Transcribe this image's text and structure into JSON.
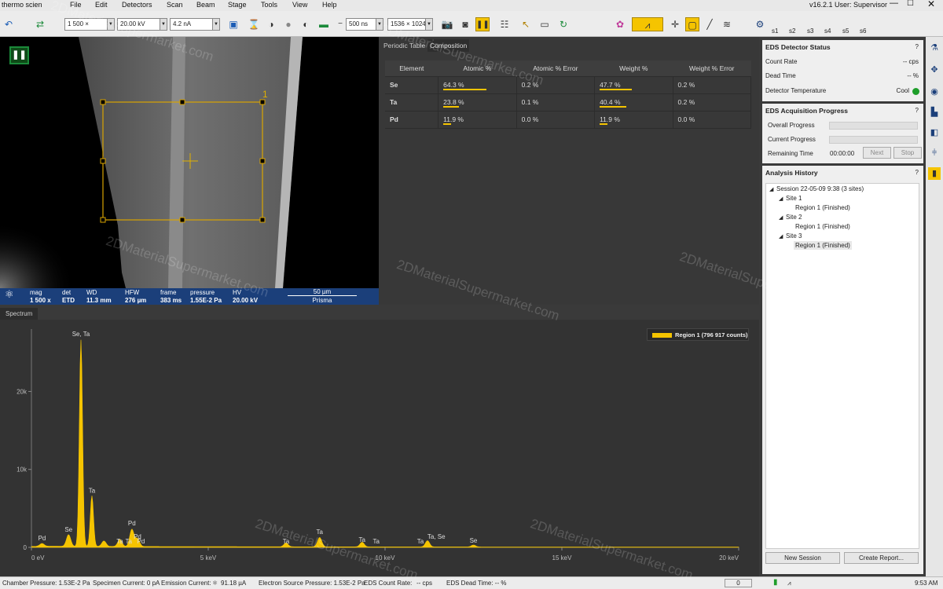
{
  "app": {
    "title": "thermo scien",
    "version": "v16.2.1",
    "user": "User: Supervisor"
  },
  "menu": [
    "File",
    "Edit",
    "Detectors",
    "Scan",
    "Beam",
    "Stage",
    "Tools",
    "View",
    "Help"
  ],
  "toolbar": {
    "mag": "1 500 ×",
    "hv": "20.00 kV",
    "current": "4.2 nA",
    "dwell": "500 ns",
    "resolution": "1536 × 1024",
    "slots": [
      "s1",
      "s2",
      "s3",
      "s4",
      "s5",
      "s6"
    ]
  },
  "image": {
    "roi_label": "1"
  },
  "databar": {
    "mag_label": "mag",
    "mag_value": "1 500 x",
    "det_label": "det",
    "det_value": "ETD",
    "wd_label": "WD",
    "wd_value": "11.3 mm",
    "hfw_label": "HFW",
    "hfw_value": "276 µm",
    "frame_label": "frame",
    "frame_value": "383 ms",
    "pressure_label": "pressure",
    "pressure_value": "1.55E-2 Pa",
    "hv_label": "HV",
    "hv_value": "20.00 kV",
    "scale_value": "50 µm",
    "footer": "Prisma"
  },
  "composition": {
    "tabs": [
      "Periodic Table",
      "Composition"
    ],
    "columns": [
      "Element",
      "Atomic %",
      "Atomic % Error",
      "Weight %",
      "Weight % Error"
    ],
    "rows": [
      {
        "element": "Se",
        "atomic": "64.3 %",
        "atomic_frac": 0.643,
        "atomic_err": "0.2 %",
        "weight": "47.7 %",
        "weight_frac": 0.477,
        "weight_err": "0.2 %"
      },
      {
        "element": "Ta",
        "atomic": "23.8 %",
        "atomic_frac": 0.238,
        "atomic_err": "0.1 %",
        "weight": "40.4 %",
        "weight_frac": 0.404,
        "weight_err": "0.2 %"
      },
      {
        "element": "Pd",
        "atomic": "11.9 %",
        "atomic_frac": 0.119,
        "atomic_err": "0.0 %",
        "weight": "11.9 %",
        "weight_frac": 0.119,
        "weight_err": "0.0 %"
      }
    ]
  },
  "spectrum_tab": "Spectrum",
  "chart_data": {
    "type": "area",
    "legend": "Region 1 (796 917 counts)",
    "legend_position": "top-right",
    "color": "#f5c400",
    "xticks": [
      "0 eV",
      "5 keV",
      "10 keV",
      "15 keV",
      "20 keV"
    ],
    "xlim": [
      0,
      20
    ],
    "yticks": [
      "20k",
      "10k",
      "0"
    ],
    "ylim": [
      0,
      28000
    ],
    "peaks": [
      {
        "x": 0.3,
        "y": 350
      },
      {
        "x": 1.05,
        "y": 1500
      },
      {
        "x": 1.4,
        "y": 26500
      },
      {
        "x": 1.71,
        "y": 6500
      },
      {
        "x": 2.05,
        "y": 700
      },
      {
        "x": 2.5,
        "y": 900
      },
      {
        "x": 2.84,
        "y": 2200
      },
      {
        "x": 3.0,
        "y": 1000
      },
      {
        "x": 7.2,
        "y": 500
      },
      {
        "x": 8.15,
        "y": 1200
      },
      {
        "x": 9.35,
        "y": 600
      },
      {
        "x": 11.2,
        "y": 800
      },
      {
        "x": 12.5,
        "y": 250
      }
    ],
    "labels": [
      {
        "x": 0.3,
        "y": 600,
        "text": "Pd"
      },
      {
        "x": 1.05,
        "y": 1700,
        "text": "Se"
      },
      {
        "x": 1.4,
        "y": 26800,
        "text": "Se, Ta"
      },
      {
        "x": 1.71,
        "y": 6700,
        "text": "Ta"
      },
      {
        "x": 2.5,
        "y": 200,
        "text": "Ta"
      },
      {
        "x": 2.84,
        "y": 2500,
        "text": "Pd"
      },
      {
        "x": 2.75,
        "y": 200,
        "text": "Ta"
      },
      {
        "x": 3.0,
        "y": 800,
        "text": "Pd"
      },
      {
        "x": 3.1,
        "y": 200,
        "text": "Pd"
      },
      {
        "x": 7.2,
        "y": 200,
        "text": "Ta"
      },
      {
        "x": 8.15,
        "y": 1400,
        "text": "Ta"
      },
      {
        "x": 9.35,
        "y": 400,
        "text": "Ta"
      },
      {
        "x": 9.75,
        "y": 200,
        "text": "Ta"
      },
      {
        "x": 11.0,
        "y": 200,
        "text": "Ta"
      },
      {
        "x": 11.45,
        "y": 800,
        "text": "Ta, Se"
      },
      {
        "x": 12.5,
        "y": 300,
        "text": "Se"
      }
    ]
  },
  "detector_status": {
    "title": "EDS Detector Status",
    "count_rate_label": "Count Rate",
    "count_rate": "-- cps",
    "dead_time_label": "Dead Time",
    "dead_time": "-- %",
    "temp_label": "Detector Temperature",
    "temp_value": "Cool",
    "temp_color": "#1e9e2a"
  },
  "acquisition": {
    "title": "EDS Acquisition Progress",
    "overall_label": "Overall Progress",
    "current_label": "Current Progress",
    "remaining_label": "Remaining Time",
    "remaining": "00:00:00",
    "next": "Next",
    "stop": "Stop"
  },
  "history": {
    "title": "Analysis History",
    "session": "Session 22-05-09 9:38 (3 sites)",
    "sites": [
      {
        "name": "Site 1",
        "region": "Region 1 (Finished)"
      },
      {
        "name": "Site 2",
        "region": "Region 1 (Finished)"
      },
      {
        "name": "Site 3",
        "region": "Region 1 (Finished)"
      }
    ],
    "new_session": "New Session",
    "create_report": "Create Report..."
  },
  "statusbar": {
    "chamber": "Chamber Pressure: 1.53E-2 Pa",
    "specimen": "Specimen Current: 0 pA",
    "emission": "Emission Current:",
    "emission_value": "91.18 µA",
    "source": "Electron Source Pressure: 1.53E-2 Pa",
    "eds_rate": "EDS Count Rate:",
    "eds_rate_value": "-- cps",
    "eds_dead": "EDS Dead Time: -- %",
    "counter": "0",
    "time": "9:53 AM"
  },
  "watermark": "2DMaterialSupermarket.com"
}
